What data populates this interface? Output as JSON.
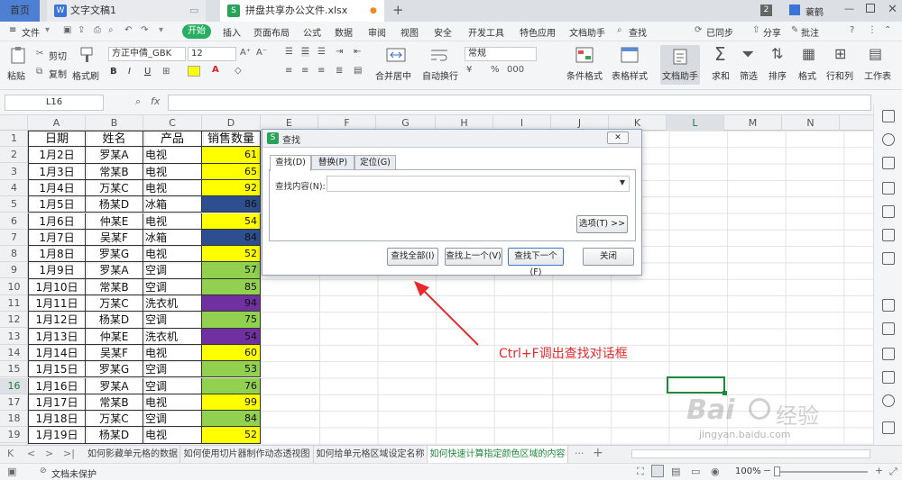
{
  "titlebar": {
    "home_tab": "首页",
    "doc_tab": "文字文稿1",
    "file_tab": "拼盘共享办公文件.xlsx",
    "page_badge": "2",
    "user_name": "蓑鹤"
  },
  "menubar": {
    "file": "文件",
    "start": "开始",
    "items": [
      "插入",
      "页面布局",
      "公式",
      "数据",
      "审阅",
      "视图",
      "安全",
      "开发工具",
      "特色应用",
      "文档助手"
    ],
    "search": "查找",
    "sync": "已同步",
    "share": "分享",
    "comment": "批注"
  },
  "ribbon": {
    "paste": "粘贴",
    "cut": "剪切",
    "copy": "复制",
    "format_painter": "格式刷",
    "font_name": "方正中倩_GBK",
    "font_size": "12",
    "bold": "B",
    "italic": "I",
    "underline": "U",
    "merge_center": "合并居中",
    "wrap_text": "自动换行",
    "number_format": "常规",
    "cond_format": "条件格式",
    "table_style": "表格样式",
    "doc_helper": "文档助手",
    "sum": "求和",
    "filter": "筛选",
    "sort": "排序",
    "format": "格式",
    "row_col": "行和列",
    "worksheet": "工作表",
    "percent": "%",
    "thousands": "000"
  },
  "formula_bar": {
    "cell_ref": "L16",
    "fx": "fx",
    "content": ""
  },
  "columns": [
    "A",
    "B",
    "C",
    "D",
    "E",
    "F",
    "G",
    "H",
    "I",
    "J",
    "K",
    "L",
    "M",
    "N"
  ],
  "rows": [
    "1",
    "2",
    "3",
    "4",
    "5",
    "6",
    "7",
    "8",
    "9",
    "10",
    "11",
    "12",
    "13",
    "14",
    "15",
    "16",
    "17",
    "18",
    "19"
  ],
  "table": {
    "headers": [
      "日期",
      "姓名",
      "产品",
      "销售数量"
    ],
    "records": [
      [
        "1月2日",
        "罗某A",
        "电视",
        "61"
      ],
      [
        "1月3日",
        "常某B",
        "电视",
        "65"
      ],
      [
        "1月4日",
        "万某C",
        "电视",
        "92"
      ],
      [
        "1月5日",
        "杨某D",
        "冰箱",
        "86"
      ],
      [
        "1月6日",
        "仲某E",
        "电视",
        "54"
      ],
      [
        "1月7日",
        "吴某F",
        "冰箱",
        "84"
      ],
      [
        "1月8日",
        "罗某G",
        "电视",
        "52"
      ],
      [
        "1月9日",
        "罗某A",
        "空调",
        "57"
      ],
      [
        "1月10日",
        "常某B",
        "空调",
        "85"
      ],
      [
        "1月11日",
        "万某C",
        "洗衣机",
        "94"
      ],
      [
        "1月12日",
        "杨某D",
        "空调",
        "75"
      ],
      [
        "1月13日",
        "仲某E",
        "洗衣机",
        "54"
      ],
      [
        "1月14日",
        "吴某F",
        "电视",
        "60"
      ],
      [
        "1月15日",
        "罗某G",
        "空调",
        "53"
      ],
      [
        "1月16日",
        "罗某A",
        "空调",
        "76"
      ],
      [
        "1月17日",
        "常某B",
        "电视",
        "99"
      ],
      [
        "1月18日",
        "万某C",
        "空调",
        "84"
      ],
      [
        "1月19日",
        "杨某D",
        "电视",
        "52"
      ]
    ],
    "qty_colors": [
      "#ffff00",
      "#ffff00",
      "#ffff00",
      "#2e4f8f",
      "#ffff00",
      "#2e4f8f",
      "#ffff00",
      "#92d050",
      "#92d050",
      "#7030a0",
      "#92d050",
      "#7030a0",
      "#ffff00",
      "#92d050",
      "#92d050",
      "#ffff00",
      "#92d050",
      "#ffff00"
    ]
  },
  "dialog": {
    "title": "查找",
    "tabs": [
      "查找(D)",
      "替换(P)",
      "定位(G)"
    ],
    "find_label": "查找内容(N):",
    "find_value": "",
    "options_button": "选项(T) >>",
    "find_all": "查找全部(I)",
    "find_prev": "查找上一个(V)",
    "find_next": "查找下一个(F)",
    "close": "关闭"
  },
  "annotation": "Ctrl+F调出查找对话框",
  "sheets": [
    "如何影藏单元格的数据",
    "如何使用切片器制作动态透视图",
    "如何给单元格区域设定名称",
    "如何快速计算指定颜色区域的内容"
  ],
  "statusbar": {
    "protect": "文档未保护",
    "zoom": "100%"
  },
  "watermark": {
    "brand": "Bai",
    "brand2": "经验",
    "url": "jingyan.baidu.com"
  }
}
